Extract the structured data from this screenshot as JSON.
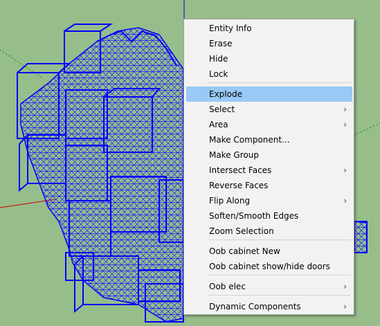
{
  "scene": {
    "background_color": "#97bd8b",
    "wireframe_color": "#0000ff",
    "axis_colors": {
      "red": "#cc0000",
      "green": "#009900",
      "blue": "#0000cc"
    }
  },
  "context_menu": {
    "items": [
      {
        "label": "Entity Info",
        "submenu": false,
        "highlighted": false
      },
      {
        "label": "Erase",
        "submenu": false,
        "highlighted": false
      },
      {
        "label": "Hide",
        "submenu": false,
        "highlighted": false
      },
      {
        "label": "Lock",
        "submenu": false,
        "highlighted": false
      },
      {
        "label": "Explode",
        "submenu": false,
        "highlighted": true
      },
      {
        "label": "Select",
        "submenu": true,
        "highlighted": false
      },
      {
        "label": "Area",
        "submenu": true,
        "highlighted": false
      },
      {
        "label": "Make Component...",
        "submenu": false,
        "highlighted": false
      },
      {
        "label": "Make Group",
        "submenu": false,
        "highlighted": false
      },
      {
        "label": "Intersect Faces",
        "submenu": true,
        "highlighted": false
      },
      {
        "label": "Reverse Faces",
        "submenu": false,
        "highlighted": false
      },
      {
        "label": "Flip Along",
        "submenu": true,
        "highlighted": false
      },
      {
        "label": "Soften/Smooth Edges",
        "submenu": false,
        "highlighted": false
      },
      {
        "label": "Zoom Selection",
        "submenu": false,
        "highlighted": false
      },
      {
        "label": "Oob cabinet New",
        "submenu": false,
        "highlighted": false
      },
      {
        "label": "Oob cabinet show/hide doors",
        "submenu": false,
        "highlighted": false
      },
      {
        "label": "Oob elec",
        "submenu": true,
        "highlighted": false
      },
      {
        "label": "Dynamic Components",
        "submenu": true,
        "highlighted": false
      }
    ],
    "submenu_arrow": "›",
    "highlight_color": "#99c9f6"
  }
}
